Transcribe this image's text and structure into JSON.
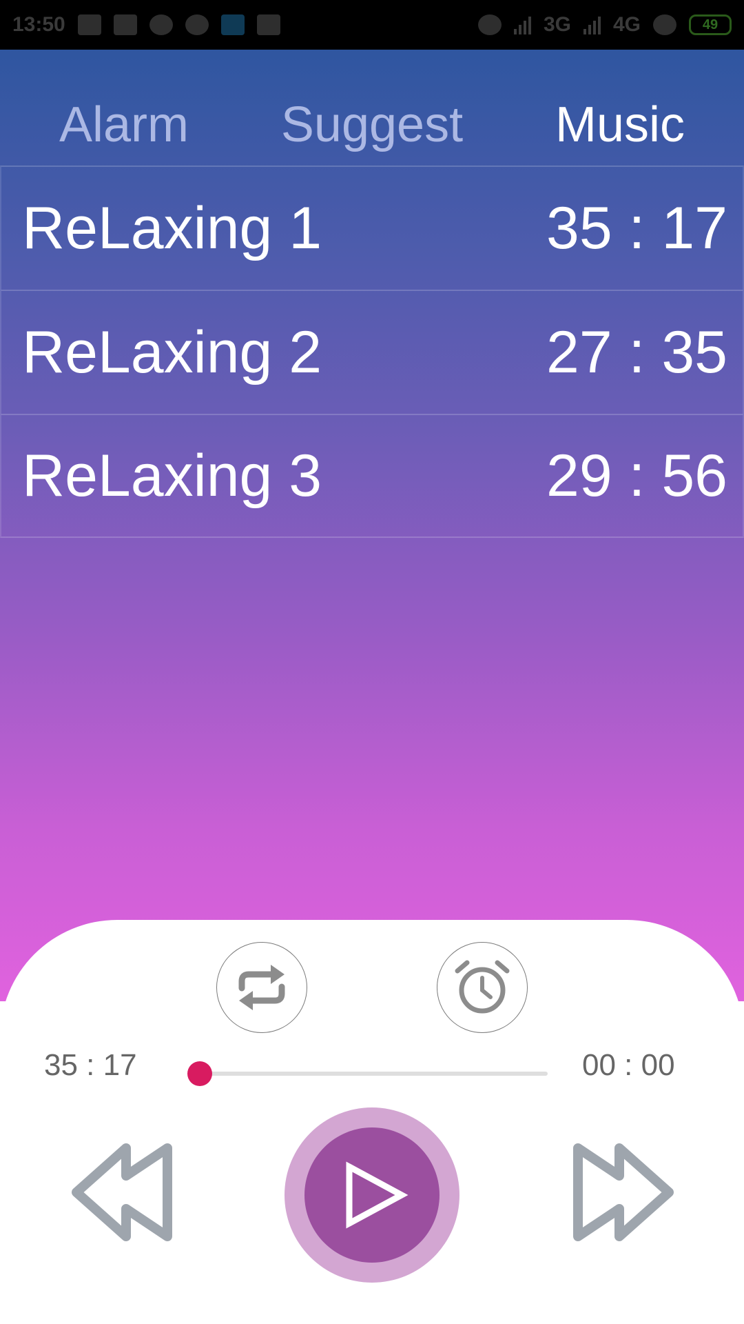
{
  "status_bar": {
    "time": "13:50",
    "network_1": "3G",
    "network_2": "4G",
    "battery": "49"
  },
  "tabs": [
    {
      "label": "Alarm",
      "active": false
    },
    {
      "label": "Suggest",
      "active": false
    },
    {
      "label": "Music",
      "active": true
    }
  ],
  "tracks": [
    {
      "name": "ReLaxing 1",
      "duration": "35 : 17"
    },
    {
      "name": "ReLaxing 2",
      "duration": "27 : 35"
    },
    {
      "name": "ReLaxing 3",
      "duration": "29 : 56"
    }
  ],
  "player": {
    "total_time": "35 : 17",
    "current_time": "00 : 00",
    "progress": 0,
    "icons": {
      "repeat": "repeat-icon",
      "timer": "alarm-clock-icon",
      "rewind": "rewind-icon",
      "play": "play-icon",
      "forward": "fast-forward-icon"
    }
  },
  "colors": {
    "gradient_top": "#2f56a0",
    "gradient_bottom": "#e062de",
    "progress_thumb": "#d81b60",
    "play_button": "#9b4f9f",
    "play_ring": "#d3a6d2",
    "nav_icon": "#9ea5ad"
  }
}
